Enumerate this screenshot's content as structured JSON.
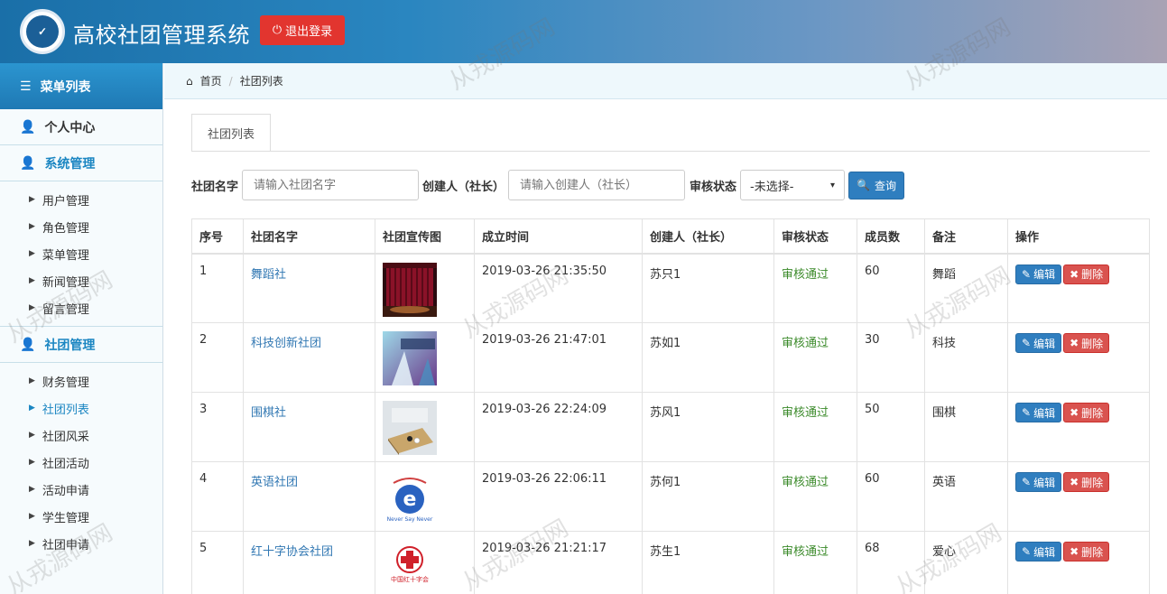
{
  "header": {
    "title": "高校社团管理系统",
    "logout_label": "退出登录"
  },
  "sidebar": {
    "header": "菜单列表",
    "personal": "个人中心",
    "system_group": "系统管理",
    "system_items": [
      "用户管理",
      "角色管理",
      "菜单管理",
      "新闻管理",
      "留言管理"
    ],
    "club_group": "社团管理",
    "club_items": [
      "财务管理",
      "社团列表",
      "社团风采",
      "社团活动",
      "活动申请",
      "学生管理",
      "社团申请"
    ],
    "active_item": "社团列表"
  },
  "breadcrumb": {
    "home": "首页",
    "current": "社团列表"
  },
  "tab": {
    "label": "社团列表"
  },
  "search": {
    "name_label": "社团名字",
    "name_placeholder": "请输入社团名字",
    "creator_label": "创建人（社长）",
    "creator_placeholder": "请输入创建人（社长）",
    "status_label": "审核状态",
    "status_selected": "-未选择-",
    "query_label": "查询"
  },
  "table": {
    "headers": [
      "序号",
      "社团名字",
      "社团宣传图",
      "成立时间",
      "创建人（社长）",
      "审核状态",
      "成员数",
      "备注",
      "操作"
    ],
    "edit_label": "编辑",
    "delete_label": "删除",
    "rows": [
      {
        "index": "1",
        "name": "舞蹈社",
        "founded": "2019-03-26 21:35:50",
        "creator": "苏只1",
        "status": "审核通过",
        "members": "60",
        "remark": "舞蹈"
      },
      {
        "index": "2",
        "name": "科技创新社团",
        "founded": "2019-03-26 21:47:01",
        "creator": "苏如1",
        "status": "审核通过",
        "members": "30",
        "remark": "科技"
      },
      {
        "index": "3",
        "name": "围棋社",
        "founded": "2019-03-26 22:24:09",
        "creator": "苏风1",
        "status": "审核通过",
        "members": "50",
        "remark": "围棋"
      },
      {
        "index": "4",
        "name": "英语社团",
        "founded": "2019-03-26 22:06:11",
        "creator": "苏何1",
        "status": "审核通过",
        "members": "60",
        "remark": "英语"
      },
      {
        "index": "5",
        "name": "红十字协会社团",
        "founded": "2019-03-26 21:21:17",
        "creator": "苏生1",
        "status": "审核通过",
        "members": "68",
        "remark": "爱心"
      }
    ]
  },
  "thumbs": {
    "english_text": "Never Say Never",
    "redcross_text": "中国红十字会"
  },
  "watermark": "从戎源码网",
  "colors": {
    "accent": "#2f7ebf",
    "danger": "#d9534f",
    "success": "#3c8b2b",
    "logout": "#e2352f"
  }
}
